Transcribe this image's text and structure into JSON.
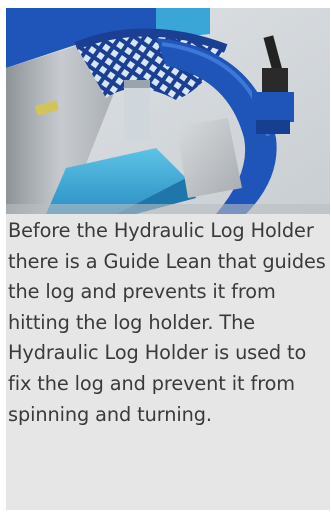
{
  "caption": {
    "text": "Before the Hydraulic Log Holder there is a Guide Lean that guides the log and prevents it from hitting the log holder. The Hydraulic Log Holder is used to fix the log and prevent it from spinning and turning."
  },
  "photo": {
    "subject": "hydraulic-log-holder-machine",
    "colors": {
      "machine_blue": "#1f54b8",
      "panel_blue": "#3aa6d8",
      "steel_grey": "#bfc4c9",
      "background": "#e6e6e6",
      "caption_text": "#3a3a3a"
    }
  }
}
